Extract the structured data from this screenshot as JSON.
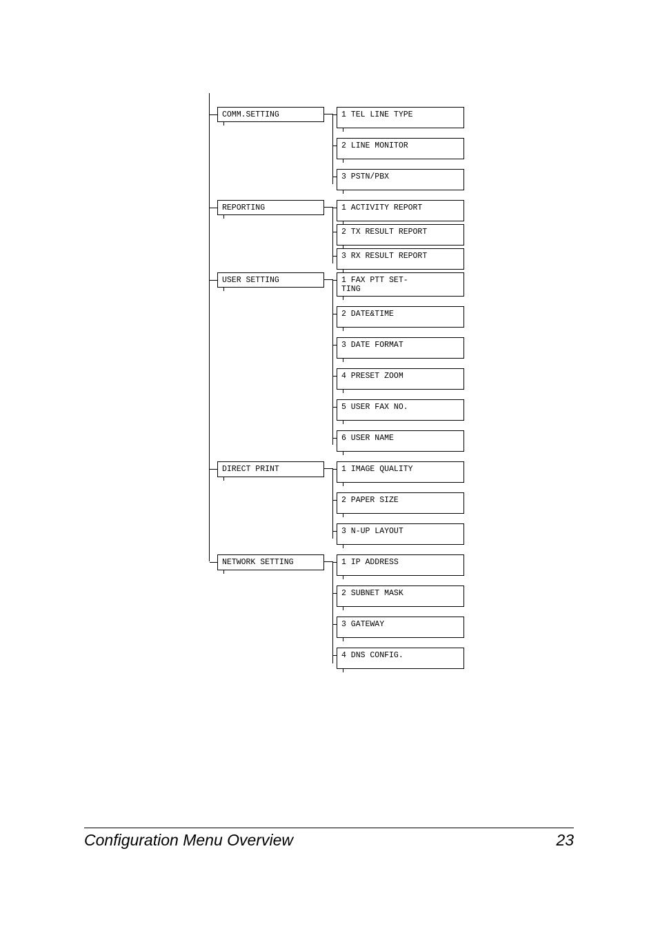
{
  "footer": {
    "title": "Configuration Menu Overview",
    "page": "23"
  },
  "menu": [
    {
      "parent": "COMM.SETTING",
      "children": [
        "1 TEL LINE TYPE",
        "2 LINE MONITOR",
        "3 PSTN/PBX"
      ]
    },
    {
      "parent": "REPORTING",
      "children": [
        "1 ACTIVITY REPORT",
        "2 TX RESULT REPORT",
        "3 RX RESULT REPORT"
      ]
    },
    {
      "parent": "USER SETTING",
      "children": [
        "1 FAX PTT SET-\nTING",
        "2 DATE&TIME",
        "3 DATE FORMAT",
        "4 PRESET ZOOM",
        "5 USER FAX NO.",
        "6 USER NAME"
      ]
    },
    {
      "parent": "DIRECT PRINT",
      "children": [
        "1 IMAGE QUALITY",
        "2 PAPER SIZE",
        "3 N-UP LAYOUT"
      ]
    },
    {
      "parent": "NETWORK SETTING",
      "children": [
        "1 IP ADDRESS",
        "2 SUBNET MASK",
        "3 GATEWAY",
        "4 DNS CONFIG."
      ]
    }
  ]
}
